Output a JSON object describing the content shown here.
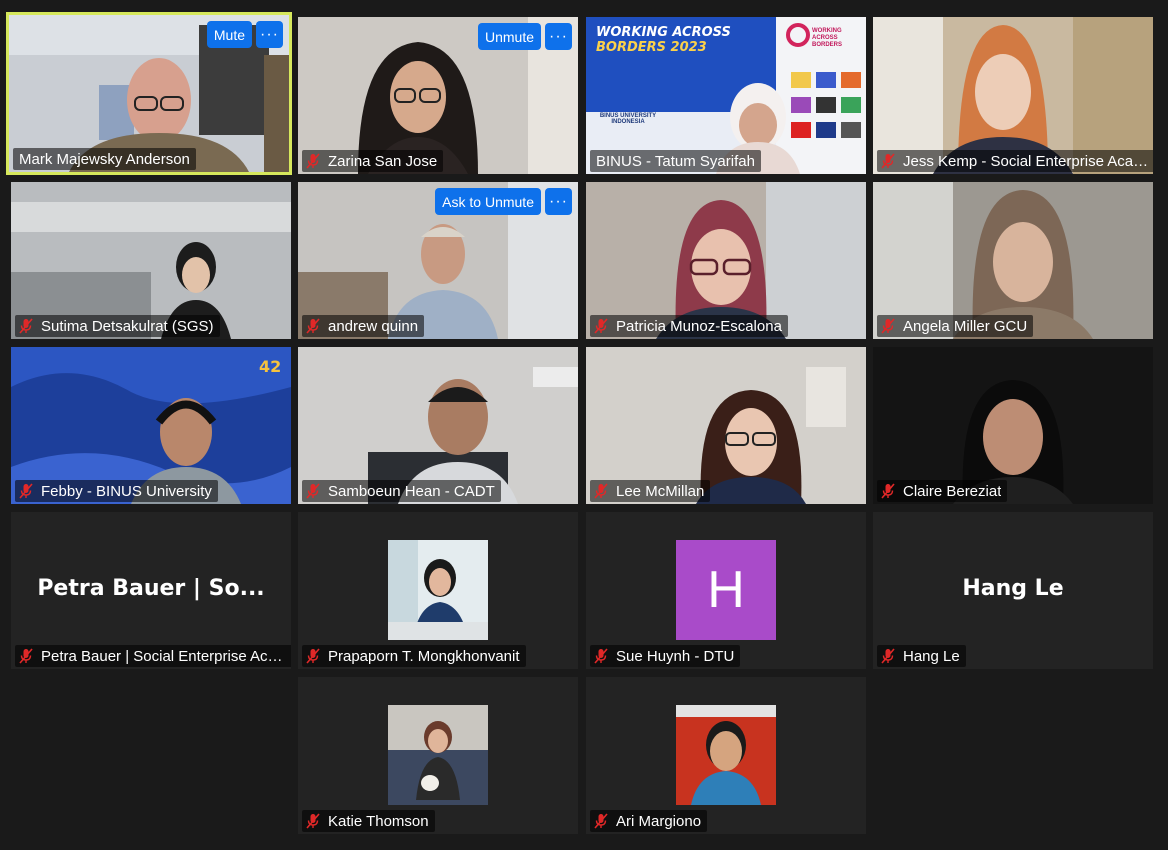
{
  "controls": {
    "mute": "Mute",
    "unmute": "Unmute",
    "ask_to_unmute": "Ask to Unmute",
    "more": "···"
  },
  "participants": [
    {
      "name": "Mark Majewsky Anderson"
    },
    {
      "name": "Zarina San Jose"
    },
    {
      "name": "BINUS - Tatum Syarifah"
    },
    {
      "name": "Jess Kemp - Social Enterprise Acad..."
    },
    {
      "name": "Sutima Detsakulrat (SGS)"
    },
    {
      "name": "andrew quinn"
    },
    {
      "name": "Patricia Munoz-Escalona"
    },
    {
      "name": "Angela Miller GCU"
    },
    {
      "name": "Febby -  BINUS University"
    },
    {
      "name": "Samboeun Hean - CADT"
    },
    {
      "name": "Lee McMillan"
    },
    {
      "name": "Claire Bereziat"
    },
    {
      "name": "Petra Bauer | Social Enterprise Aca...",
      "display": "Petra Bauer | So..."
    },
    {
      "name": "Prapaporn T.  Mongkhonvanit"
    },
    {
      "name": "Sue Huynh - DTU",
      "avatar_letter": "H"
    },
    {
      "name": "Hang Le",
      "display": "Hang Le"
    },
    {
      "name": "Katie Thomson"
    },
    {
      "name": "Ari Margiono"
    }
  ],
  "banner": {
    "line1": "WORKING ACROSS",
    "line2": "BORDERS 2023",
    "logo_text": "WORKING ACROSS BORDERS",
    "university": "BINUS UNIVERSITY",
    "country": "INDONESIA"
  },
  "colors": {
    "accent": "#0e71eb",
    "active_speaker": "#d6e85c",
    "muted_icon": "#e02828",
    "avatar_h": "#a94bc9"
  }
}
